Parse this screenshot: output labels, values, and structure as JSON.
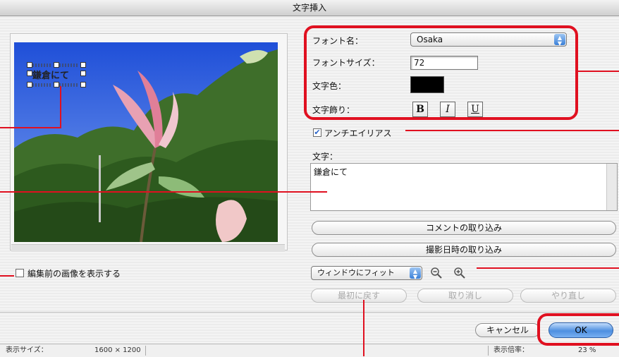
{
  "window": {
    "title": "文字挿入"
  },
  "preview": {
    "overlay_text": "鎌倉にて",
    "show_original_label": "編集前の画像を表示する",
    "show_original_checked": false
  },
  "font": {
    "name_label": "フォント名：",
    "name_value": "Osaka",
    "size_label": "フォントサイズ：",
    "size_value": "72",
    "color_label": "文字色：",
    "color_value": "#000000",
    "style_label": "文字飾り：",
    "bold": "B",
    "italic": "I",
    "underline": "U"
  },
  "antialias": {
    "label": "アンチエイリアス",
    "checked": true
  },
  "text": {
    "label": "文字：",
    "value": "鎌倉にて"
  },
  "buttons": {
    "import_comment": "コメントの取り込み",
    "import_date": "撮影日時の取り込み",
    "revert": "最初に戻す",
    "undo": "取り消し",
    "redo": "やり直し",
    "cancel": "キャンセル",
    "ok": "OK"
  },
  "zoom": {
    "fit_value": "ウィンドウにフィット",
    "zoom_out_icon": "zoom-out-icon",
    "zoom_in_icon": "zoom-in-icon"
  },
  "status": {
    "size_label": "表示サイズ：",
    "size_value": "1600 × 1200",
    "zoom_label": "表示倍率：",
    "zoom_value": "23 %"
  },
  "colors": {
    "annotation_red": "#e01020",
    "default_button": "#4e8fe0"
  }
}
